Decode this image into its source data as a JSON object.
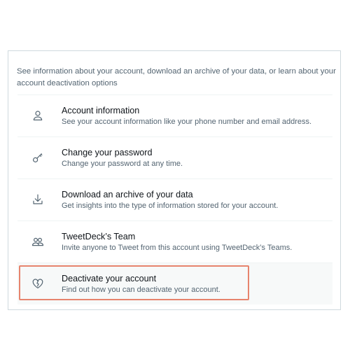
{
  "intro_text": "See information about your account, download an archive of your data, or learn about your account deactivation options",
  "settings": [
    {
      "icon": "person-icon",
      "title": "Account information",
      "description": "See your account information like your phone number and email address."
    },
    {
      "icon": "key-icon",
      "title": "Change your password",
      "description": "Change your password at any time."
    },
    {
      "icon": "download-icon",
      "title": "Download an archive of your data",
      "description": "Get insights into the type of information stored for your account."
    },
    {
      "icon": "people-icon",
      "title": "TweetDeck’s Team",
      "description": "Invite anyone to Tweet from this account using TweetDeck’s Teams."
    },
    {
      "icon": "broken-heart-icon",
      "title": "Deactivate your account",
      "description": "Find out how you can deactivate your account."
    }
  ],
  "colors": {
    "highlight_border": "#e7846d",
    "secondary_text": "#536471",
    "primary_text": "#0f1419",
    "divider": "#eff3f4"
  }
}
